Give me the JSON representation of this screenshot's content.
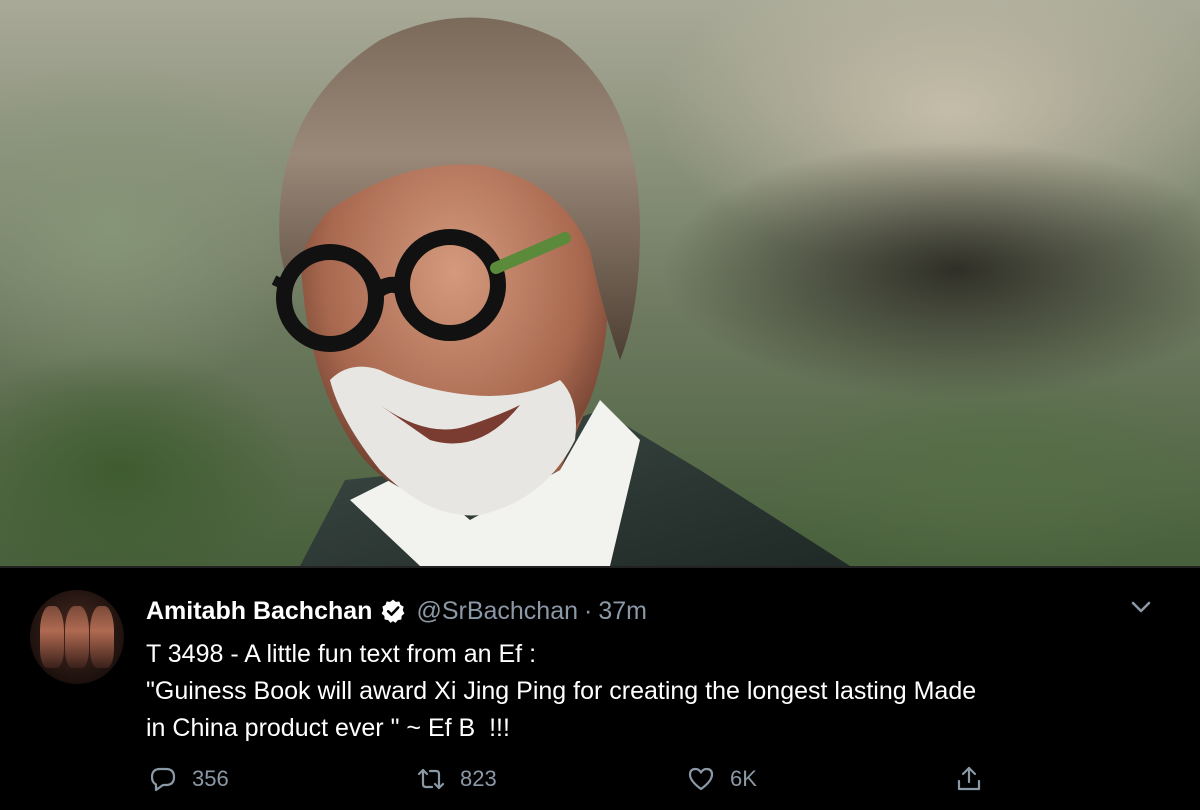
{
  "tweet": {
    "author_name": "Amitabh Bachchan",
    "handle": "@SrBachchan",
    "separator": "·",
    "time": "37m",
    "text_lines": [
      "T 3498 - A little fun text from an Ef :",
      "\"Guiness Book will award Xi Jing Ping for creating the longest lasting Made",
      "in China product ever \" ~ Ef B  !!!"
    ],
    "reply_count": "356",
    "retweet_count": "823",
    "like_count": "6K"
  },
  "icons": {
    "verified": "verified-badge-icon",
    "more": "chevron-down-icon",
    "reply": "reply-icon",
    "retweet": "retweet-icon",
    "like": "heart-icon",
    "share": "share-icon"
  },
  "colors": {
    "background": "#000000",
    "text": "#ffffff",
    "muted": "#8b98a5"
  }
}
